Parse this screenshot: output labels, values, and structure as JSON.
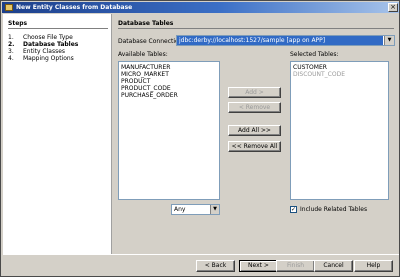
{
  "window": {
    "title": "New Entity Classes from Database",
    "close_glyph": "×"
  },
  "steps": {
    "heading": "Steps",
    "items": [
      {
        "num": "1.",
        "label": "Choose File Type",
        "current": false
      },
      {
        "num": "2.",
        "label": "Database Tables",
        "current": true
      },
      {
        "num": "3.",
        "label": "Entity Classes",
        "current": false
      },
      {
        "num": "4.",
        "label": "Mapping Options",
        "current": false
      }
    ]
  },
  "main": {
    "heading": "Database Tables",
    "connection_label": "Database Connection:",
    "connection_value": "jdbc:derby://localhost:1527/sample [app on APP]",
    "available_label": "Available Tables:",
    "selected_label": "Selected Tables:",
    "available_tables": [
      "MANUFACTURER",
      "MICRO_MARKET",
      "PRODUCT",
      "PRODUCT_CODE",
      "PURCHASE_ORDER"
    ],
    "selected_tables": [
      {
        "name": "CUSTOMER",
        "greyed": false
      },
      {
        "name": "DISCOUNT_CODE",
        "greyed": true
      }
    ],
    "buttons": {
      "add": "Add >",
      "remove": "< Remove",
      "add_all": "Add All >>",
      "remove_all": "<< Remove All"
    },
    "filter_value": "Any",
    "include_related": {
      "label": "Include Related Tables",
      "checked": true,
      "mark": "✓"
    }
  },
  "footer": {
    "back": "< Back",
    "next": "Next >",
    "finish": "Finish",
    "cancel": "Cancel",
    "help": "Help"
  },
  "icons": {
    "dropdown_arrow": "▼"
  },
  "colors": {
    "selection": "#316ac5",
    "titlebar": "#1d3f8a",
    "disabled_text": "#9a9a9a"
  }
}
